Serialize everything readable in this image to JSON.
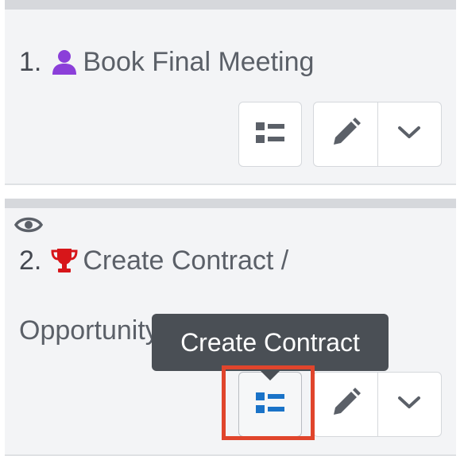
{
  "steps": [
    {
      "number": "1.",
      "icon": "user-icon",
      "icon_color": "#8b3fd9",
      "title": "Book Final Meeting"
    },
    {
      "number": "2.",
      "icon": "trophy-icon",
      "icon_color": "#d7161a",
      "title": "Create Contract /",
      "title_line2": "Opportunity",
      "status_icon": "eye-icon"
    }
  ],
  "tooltip": {
    "text": "Create Contract"
  },
  "colors": {
    "card_background": "#f3f4f6",
    "icon_gray": "#5b6068",
    "details_active_blue": "#1a73c8",
    "highlight_red": "#e0452c",
    "tooltip_background": "#4a4f55"
  },
  "buttons": {
    "details_icon": "details-list-icon",
    "edit_icon": "pencil-icon",
    "menu_icon": "chevron-down-icon"
  }
}
